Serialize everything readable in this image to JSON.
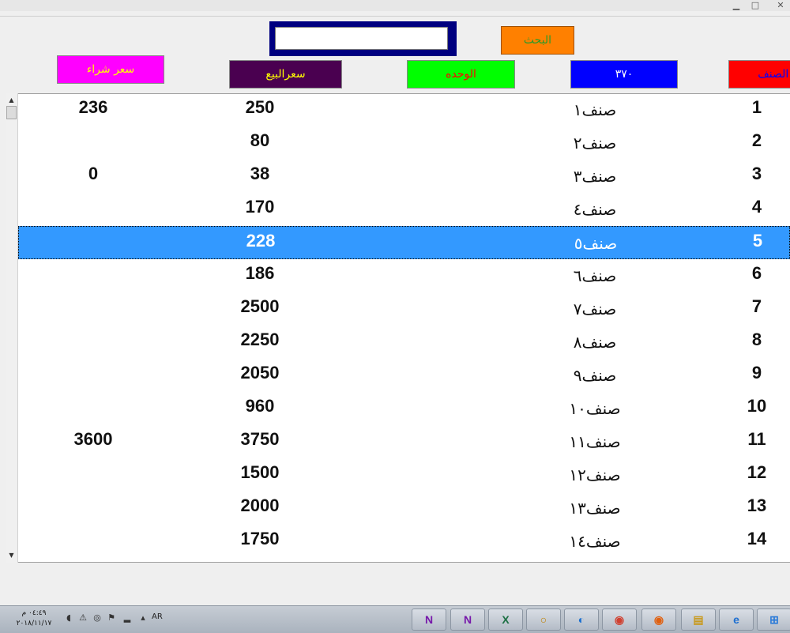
{
  "window": {
    "title": "",
    "minimize_icon": "minimize-icon",
    "close_icon": "close-icon"
  },
  "search": {
    "value": "",
    "button_label": "البحث"
  },
  "headers": {
    "buy_price": "سعر شراء",
    "sale_price": "سعرالبيع",
    "unit": "الوحده",
    "count": "٣٧٠",
    "category": "د الصنف"
  },
  "rows": [
    {
      "id": "1",
      "name": "صنف١",
      "sale": "250",
      "buy": "236"
    },
    {
      "id": "2",
      "name": "صنف٢",
      "sale": "80",
      "buy": ""
    },
    {
      "id": "3",
      "name": "صنف٣",
      "sale": "38",
      "buy": "0"
    },
    {
      "id": "4",
      "name": "صنف٤",
      "sale": "170",
      "buy": ""
    },
    {
      "id": "5",
      "name": "صنف٥",
      "sale": "228",
      "buy": ""
    },
    {
      "id": "6",
      "name": "صنف٦",
      "sale": "186",
      "buy": ""
    },
    {
      "id": "7",
      "name": "صنف٧",
      "sale": "2500",
      "buy": ""
    },
    {
      "id": "8",
      "name": "صنف٨",
      "sale": "2250",
      "buy": ""
    },
    {
      "id": "9",
      "name": "صنف٩",
      "sale": "2050",
      "buy": ""
    },
    {
      "id": "10",
      "name": "صنف١٠",
      "sale": "960",
      "buy": ""
    },
    {
      "id": "11",
      "name": "صنف١١",
      "sale": "3750",
      "buy": "3600"
    },
    {
      "id": "12",
      "name": "صنف١٢",
      "sale": "1500",
      "buy": ""
    },
    {
      "id": "13",
      "name": "صنف١٣",
      "sale": "2000",
      "buy": ""
    },
    {
      "id": "14",
      "name": "صنف١٤",
      "sale": "1750",
      "buy": ""
    }
  ],
  "selected_row": 4,
  "scrollbar": {
    "up_icon": "scroll-up-arrow-icon",
    "down_icon": "scroll-down-arrow-icon"
  },
  "taskbar": {
    "time": "٠٤:٤٩ م",
    "date": "٢٠١٨/١١/١٧",
    "language": "AR",
    "tray_icons": [
      "volume-icon",
      "security-icon",
      "network-icon",
      "flag-icon",
      "signal-icon",
      "show-hidden-icon"
    ],
    "apps": [
      {
        "icon": "onenote-icon",
        "glyph": "N",
        "color": "#7719aa"
      },
      {
        "icon": "onenote-icon",
        "glyph": "N",
        "color": "#7719aa"
      },
      {
        "icon": "excel-icon",
        "glyph": "X",
        "color": "#1d7044"
      },
      {
        "icon": "search-app-icon",
        "glyph": "○",
        "color": "#c08000"
      },
      {
        "icon": "swirl-app-icon",
        "glyph": "◐",
        "color": "#1a6fd0"
      },
      {
        "icon": "chrome-icon",
        "glyph": "◉",
        "color": "#d04030"
      },
      {
        "icon": "firefox-icon",
        "glyph": "◉",
        "color": "#e06010"
      },
      {
        "icon": "file-explorer-icon",
        "glyph": "▤",
        "color": "#c89a20"
      },
      {
        "icon": "internet-explorer-icon",
        "glyph": "e",
        "color": "#1c6ed0"
      },
      {
        "icon": "start-icon",
        "glyph": "⊞",
        "color": "#2a7ad8"
      }
    ]
  }
}
